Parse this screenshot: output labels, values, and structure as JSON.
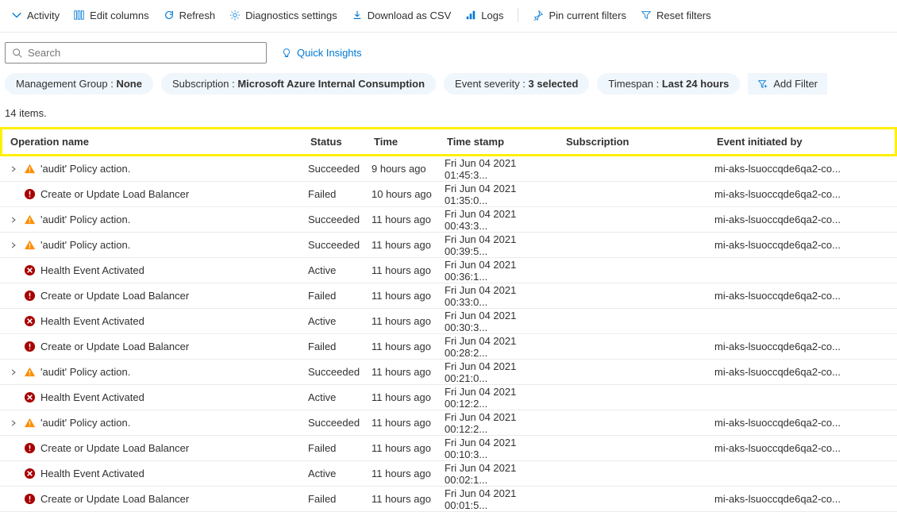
{
  "toolbar": {
    "activity": "Activity",
    "edit_columns": "Edit columns",
    "refresh": "Refresh",
    "diagnostics": "Diagnostics settings",
    "download": "Download as CSV",
    "logs": "Logs",
    "pin": "Pin current filters",
    "reset": "Reset filters"
  },
  "search": {
    "placeholder": "Search"
  },
  "quick_insights": "Quick Insights",
  "filters": {
    "mg_label": "Management Group : ",
    "mg_value": "None",
    "sub_label": "Subscription : ",
    "sub_value": "Microsoft Azure Internal Consumption",
    "sev_label": "Event severity : ",
    "sev_value": "3 selected",
    "span_label": "Timespan : ",
    "span_value": "Last 24 hours",
    "add": "Add Filter"
  },
  "count": "14 items.",
  "columns": {
    "op": "Operation name",
    "status": "Status",
    "time": "Time",
    "ts": "Time stamp",
    "sub": "Subscription",
    "init": "Event initiated by"
  },
  "rows": [
    {
      "exp": true,
      "icon": "warn",
      "op": "'audit' Policy action.",
      "status": "Succeeded",
      "time": "9 hours ago",
      "ts": "Fri Jun 04 2021 01:45:3...",
      "sub": "",
      "init": "mi-aks-lsuoccqde6qa2-co..."
    },
    {
      "exp": false,
      "icon": "err",
      "op": "Create or Update Load Balancer",
      "status": "Failed",
      "time": "10 hours ago",
      "ts": "Fri Jun 04 2021 01:35:0...",
      "sub": "",
      "init": "mi-aks-lsuoccqde6qa2-co..."
    },
    {
      "exp": true,
      "icon": "warn",
      "op": "'audit' Policy action.",
      "status": "Succeeded",
      "time": "11 hours ago",
      "ts": "Fri Jun 04 2021 00:43:3...",
      "sub": "",
      "init": "mi-aks-lsuoccqde6qa2-co..."
    },
    {
      "exp": true,
      "icon": "warn",
      "op": "'audit' Policy action.",
      "status": "Succeeded",
      "time": "11 hours ago",
      "ts": "Fri Jun 04 2021 00:39:5...",
      "sub": "",
      "init": "mi-aks-lsuoccqde6qa2-co..."
    },
    {
      "exp": false,
      "icon": "circ",
      "op": "Health Event Activated",
      "status": "Active",
      "time": "11 hours ago",
      "ts": "Fri Jun 04 2021 00:36:1...",
      "sub": "",
      "init": ""
    },
    {
      "exp": false,
      "icon": "err",
      "op": "Create or Update Load Balancer",
      "status": "Failed",
      "time": "11 hours ago",
      "ts": "Fri Jun 04 2021 00:33:0...",
      "sub": "",
      "init": "mi-aks-lsuoccqde6qa2-co..."
    },
    {
      "exp": false,
      "icon": "circ",
      "op": "Health Event Activated",
      "status": "Active",
      "time": "11 hours ago",
      "ts": "Fri Jun 04 2021 00:30:3...",
      "sub": "",
      "init": ""
    },
    {
      "exp": false,
      "icon": "err",
      "op": "Create or Update Load Balancer",
      "status": "Failed",
      "time": "11 hours ago",
      "ts": "Fri Jun 04 2021 00:28:2...",
      "sub": "",
      "init": "mi-aks-lsuoccqde6qa2-co..."
    },
    {
      "exp": true,
      "icon": "warn",
      "op": "'audit' Policy action.",
      "status": "Succeeded",
      "time": "11 hours ago",
      "ts": "Fri Jun 04 2021 00:21:0...",
      "sub": "",
      "init": "mi-aks-lsuoccqde6qa2-co..."
    },
    {
      "exp": false,
      "icon": "circ",
      "op": "Health Event Activated",
      "status": "Active",
      "time": "11 hours ago",
      "ts": "Fri Jun 04 2021 00:12:2...",
      "sub": "",
      "init": ""
    },
    {
      "exp": true,
      "icon": "warn",
      "op": "'audit' Policy action.",
      "status": "Succeeded",
      "time": "11 hours ago",
      "ts": "Fri Jun 04 2021 00:12:2...",
      "sub": "",
      "init": "mi-aks-lsuoccqde6qa2-co..."
    },
    {
      "exp": false,
      "icon": "err",
      "op": "Create or Update Load Balancer",
      "status": "Failed",
      "time": "11 hours ago",
      "ts": "Fri Jun 04 2021 00:10:3...",
      "sub": "",
      "init": "mi-aks-lsuoccqde6qa2-co..."
    },
    {
      "exp": false,
      "icon": "circ",
      "op": "Health Event Activated",
      "status": "Active",
      "time": "11 hours ago",
      "ts": "Fri Jun 04 2021 00:02:1...",
      "sub": "",
      "init": ""
    },
    {
      "exp": false,
      "icon": "err",
      "op": "Create or Update Load Balancer",
      "status": "Failed",
      "time": "11 hours ago",
      "ts": "Fri Jun 04 2021 00:01:5...",
      "sub": "",
      "init": "mi-aks-lsuoccqde6qa2-co..."
    }
  ]
}
